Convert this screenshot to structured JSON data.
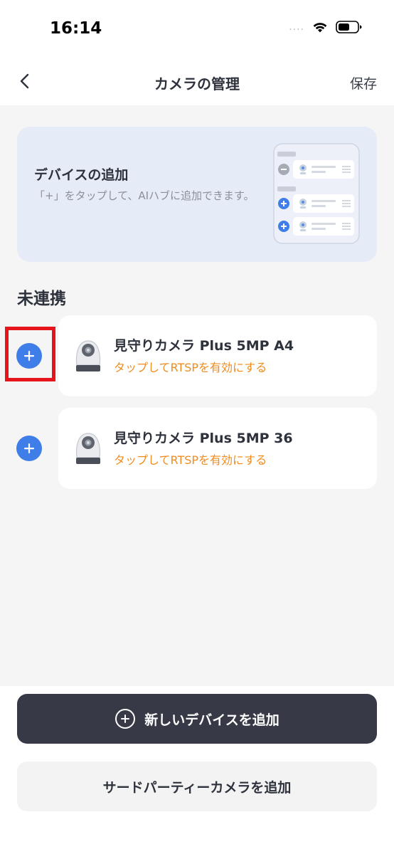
{
  "status_bar": {
    "time": "16:14",
    "signal": "....",
    "icons": [
      "wifi-icon",
      "battery-icon"
    ]
  },
  "nav": {
    "title": "カメラの管理",
    "save_label": "保存",
    "back_icon": "chevron-left-icon"
  },
  "banner": {
    "title": "デバイスの追加",
    "description": "「+」をタップして、AIハブに追加できます。"
  },
  "section": {
    "title": "未連携"
  },
  "devices": [
    {
      "name": "見守りカメラ Plus 5MP A4",
      "action": "タップしてRTSPを有効にする"
    },
    {
      "name": "見守りカメラ Plus 5MP 36",
      "action": "タップしてRTSPを有効にする"
    }
  ],
  "buttons": {
    "add_new_device": "新しいデバイスを追加",
    "add_third_party": "サードパーティーカメラを追加"
  },
  "colors": {
    "accent_blue": "#3f7ee8",
    "action_orange": "#f08c1e",
    "primary_button": "#373a46",
    "banner_bg": "#e6ebf8",
    "highlight": "#e8141b"
  }
}
